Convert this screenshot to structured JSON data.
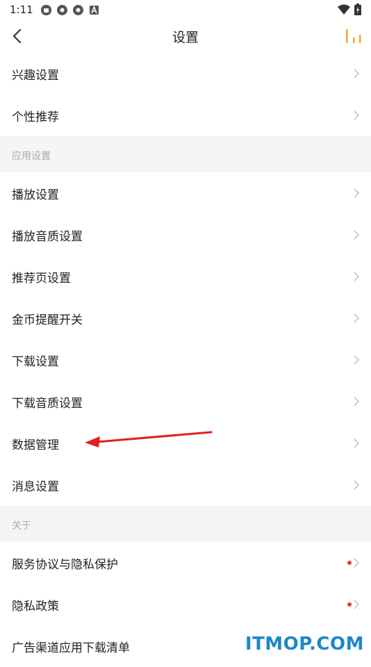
{
  "status": {
    "time": "1:11"
  },
  "header": {
    "title": "设置"
  },
  "items_top": [
    {
      "label": "兴趣设置"
    },
    {
      "label": "个性推荐"
    }
  ],
  "section_app": {
    "label": "应用设置"
  },
  "items_app": [
    {
      "label": "播放设置"
    },
    {
      "label": "播放音质设置"
    },
    {
      "label": "推荐页设置"
    },
    {
      "label": "金币提醒开关"
    },
    {
      "label": "下载设置"
    },
    {
      "label": "下载音质设置"
    },
    {
      "label": "数据管理"
    },
    {
      "label": "消息设置"
    }
  ],
  "section_about": {
    "label": "关于"
  },
  "items_about": [
    {
      "label": "服务协议与隐私保护",
      "badge": true
    },
    {
      "label": "隐私政策",
      "badge": true
    },
    {
      "label": "广告渠道应用下载清单"
    }
  ],
  "watermark": "ITMOP.COM",
  "colors": {
    "accent": "#f5a623",
    "badge": "#e8382f",
    "annotation_arrow": "#e02020"
  }
}
